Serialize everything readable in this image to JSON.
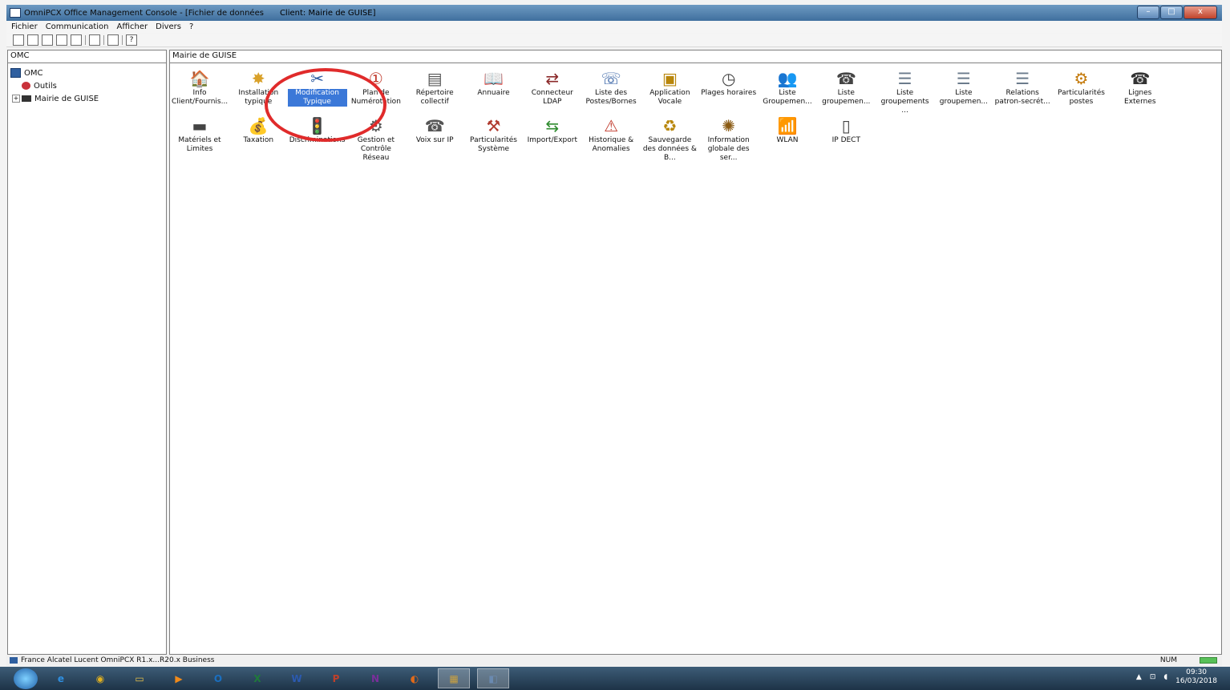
{
  "window": {
    "title": "OmniPCX Office Management Console - [Fichier de données",
    "client": "Client: Mairie de GUISE]",
    "buttons": {
      "minimize": "–",
      "maximize": "□",
      "close": "x"
    }
  },
  "menu": [
    "Fichier",
    "Communication",
    "Afficher",
    "Divers",
    "?"
  ],
  "left_pane": {
    "header": "OMC",
    "tree": [
      {
        "label": "OMC",
        "icon": "omc-icon"
      },
      {
        "label": "Outils",
        "icon": "tools-icon"
      },
      {
        "label": "Mairie de GUISE",
        "icon": "pbx-icon"
      }
    ]
  },
  "right_pane": {
    "header": "Mairie de GUISE",
    "items": [
      {
        "label": "Info Client/Fournis...",
        "icon": "customer-info-icon",
        "glyph": "🏠"
      },
      {
        "label": "Installation typique",
        "icon": "typical-installation-icon",
        "glyph": "✸"
      },
      {
        "label": "Modification Typique",
        "icon": "typical-modification-icon",
        "glyph": "✂"
      },
      {
        "label": "Plan de Numérotation",
        "icon": "numbering-plan-icon",
        "glyph": "①"
      },
      {
        "label": "Répertoire collectif",
        "icon": "directory-icon",
        "glyph": "▤"
      },
      {
        "label": "Annuaire",
        "icon": "phonebook-icon",
        "glyph": "📖"
      },
      {
        "label": "Connecteur LDAP",
        "icon": "ldap-icon",
        "glyph": "⇄"
      },
      {
        "label": "Liste des Postes/Bornes",
        "icon": "stations-icon",
        "glyph": "☏"
      },
      {
        "label": "Application Vocale",
        "icon": "voice-app-icon",
        "glyph": "▣"
      },
      {
        "label": "Plages horaires",
        "icon": "clock-icon",
        "glyph": "◷"
      },
      {
        "label": "Liste Groupemen...",
        "icon": "group-list-icon",
        "glyph": "👥"
      },
      {
        "label": "Liste groupemen...",
        "icon": "hunt-group-icon",
        "glyph": "☎"
      },
      {
        "label": "Liste groupements ...",
        "icon": "list-icon",
        "glyph": "☰"
      },
      {
        "label": "Liste groupemen...",
        "icon": "list-icon-2",
        "glyph": "☰"
      },
      {
        "label": "Relations patron-secrét...",
        "icon": "relations-icon",
        "glyph": "☰"
      },
      {
        "label": "Particularités postes",
        "icon": "station-features-icon",
        "glyph": "⚙"
      },
      {
        "label": "Lignes Externes",
        "icon": "external-lines-icon",
        "glyph": "☎"
      },
      {
        "label": "Matériels et Limites",
        "icon": "hardware-icon",
        "glyph": "▬"
      },
      {
        "label": "Taxation",
        "icon": "money-bag-icon",
        "glyph": "💰"
      },
      {
        "label": "Discriminations",
        "icon": "traffic-light-icon",
        "glyph": "🚦"
      },
      {
        "label": "Gestion et Contrôle Réseau",
        "icon": "network-icon",
        "glyph": "⚙"
      },
      {
        "label": "Voix sur IP",
        "icon": "voip-icon",
        "glyph": "☎"
      },
      {
        "label": "Particularités Système",
        "icon": "system-features-icon",
        "glyph": "⚒"
      },
      {
        "label": "Import/Export",
        "icon": "import-export-icon",
        "glyph": "⇆"
      },
      {
        "label": "Historique & Anomalies",
        "icon": "warning-icon",
        "glyph": "⚠"
      },
      {
        "label": "Sauvegarde des données & B...",
        "icon": "backup-icon",
        "glyph": "♻"
      },
      {
        "label": "Information globale des ser...",
        "icon": "services-info-icon",
        "glyph": "✺"
      },
      {
        "label": "WLAN",
        "icon": "wlan-icon",
        "glyph": "📶"
      },
      {
        "label": "IP DECT",
        "icon": "ip-dect-icon",
        "glyph": "▯"
      }
    ],
    "selected_index": 2
  },
  "status": {
    "text": "France Alcatel Lucent OmniPCX R1.x...R20.x Business",
    "num": "NUM"
  },
  "taskbar": {
    "apps": [
      {
        "name": "ie-icon",
        "glyph": "e"
      },
      {
        "name": "chrome-icon",
        "glyph": "◉"
      },
      {
        "name": "explorer-icon",
        "glyph": "▭"
      },
      {
        "name": "media-player-icon",
        "glyph": "▶"
      },
      {
        "name": "outlook-icon",
        "glyph": "O"
      },
      {
        "name": "excel-icon",
        "glyph": "X"
      },
      {
        "name": "word-icon",
        "glyph": "W"
      },
      {
        "name": "powerpoint-icon",
        "glyph": "P"
      },
      {
        "name": "onenote-icon",
        "glyph": "N"
      },
      {
        "name": "firefox-icon",
        "glyph": "◐"
      },
      {
        "name": "tool-app-icon",
        "glyph": "▦"
      },
      {
        "name": "omc-app-icon",
        "glyph": "◧"
      }
    ],
    "time": "09:30",
    "date": "16/03/2018"
  }
}
